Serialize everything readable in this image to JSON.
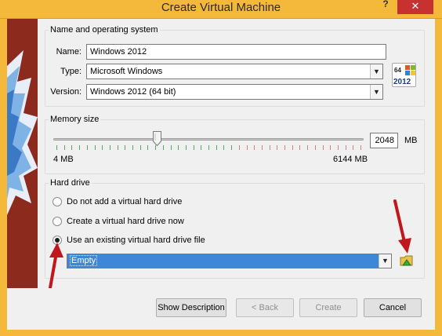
{
  "window": {
    "title": "Create Virtual Machine",
    "help_glyph": "?",
    "close_glyph": "✕"
  },
  "name_group": {
    "legend": "Name and operating system",
    "name_label": "Name:",
    "name_value": "Windows 2012",
    "type_label": "Type:",
    "type_value": "Microsoft Windows",
    "version_label": "Version:",
    "version_value": "Windows 2012 (64 bit)",
    "os_badge_top": "64",
    "os_badge_bottom": "2012"
  },
  "memory_group": {
    "legend": "Memory size",
    "min_label": "4 MB",
    "max_label": "6144 MB",
    "value": "2048",
    "unit": "MB",
    "slider_fraction": 0.333
  },
  "hd_group": {
    "legend": "Hard drive",
    "options": [
      {
        "label": "Do not add a virtual hard drive",
        "checked": false
      },
      {
        "label": "Create a virtual hard drive now",
        "checked": false
      },
      {
        "label": "Use an existing virtual hard drive file",
        "checked": true
      }
    ],
    "file_value": "Empty"
  },
  "buttons": {
    "show_description": "Show Description",
    "back": "< Back",
    "create": "Create",
    "cancel": "Cancel"
  },
  "colors": {
    "frame": "#f4b83a",
    "close": "#c7312f",
    "selection": "#3d87d6",
    "arrow": "#c0171c"
  }
}
